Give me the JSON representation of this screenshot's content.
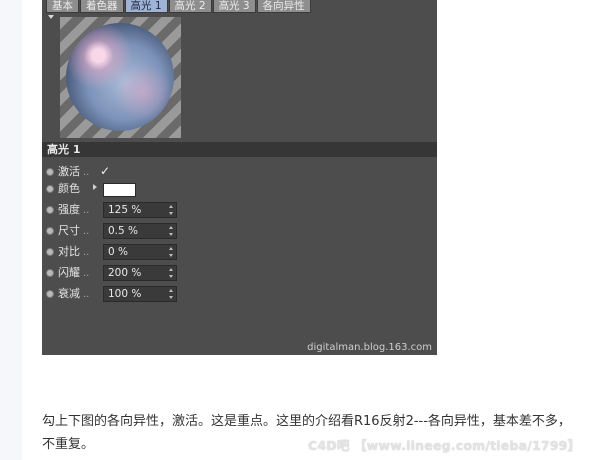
{
  "tabs": [
    {
      "label": "基本",
      "active": false
    },
    {
      "label": "着色器",
      "active": false
    },
    {
      "label": "高光 1",
      "active": true
    },
    {
      "label": "高光 2",
      "active": false
    },
    {
      "label": "高光 3",
      "active": false
    },
    {
      "label": "各向异性",
      "active": false
    }
  ],
  "section_title": "高光 1",
  "props": {
    "activate": {
      "label": "激活",
      "checked_glyph": "✓"
    },
    "color": {
      "label": "颜色",
      "value_hex": "#ffffff"
    },
    "strength": {
      "label": "强度",
      "value": "125 %"
    },
    "size": {
      "label": "尺寸",
      "value": "0.5 %"
    },
    "contrast": {
      "label": "对比",
      "value": "0 %"
    },
    "glare": {
      "label": "闪耀",
      "value": "200 %"
    },
    "falloff": {
      "label": "衰减",
      "value": "100 %"
    }
  },
  "dots": "..",
  "panel_watermark": "digitalman.blog.163.com",
  "article": {
    "line1": "勾上下图的各向异性，激活。这是重点。这里的介绍看R16反射2---各向异性，基本差不多，",
    "line2": "不重复。"
  },
  "overlay_watermark": "C4D吧 【www.lineeg.com/tieba/1799】",
  "colors": {
    "panel_bg": "#4d4d4d",
    "active_tab": "#9fb3d6",
    "field_bg": "#3a3a3a"
  }
}
